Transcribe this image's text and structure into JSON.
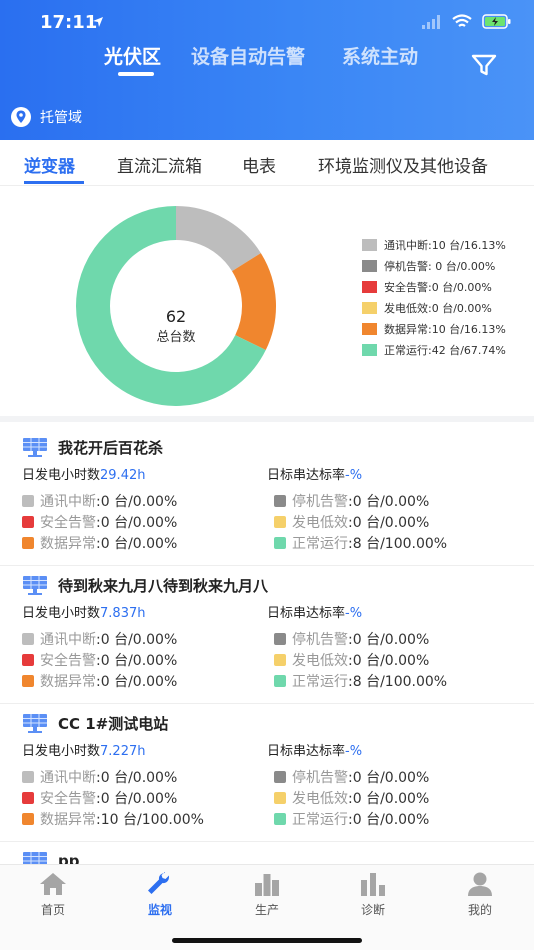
{
  "status_bar": {
    "time": "17:11"
  },
  "top_tabs": [
    {
      "label": "光伏区",
      "active": true
    },
    {
      "label": "设备自动告警",
      "active": false
    },
    {
      "label": "系统主动",
      "active": false
    }
  ],
  "domain": {
    "label": "托管域"
  },
  "sub_tabs": [
    {
      "label": "逆变器",
      "active": true
    },
    {
      "label": "直流汇流箱",
      "active": false
    },
    {
      "label": "电表",
      "active": false
    },
    {
      "label": "环境监测仪及其他设备",
      "active": false
    }
  ],
  "summary": {
    "total_value": "62",
    "total_label": "总台数",
    "legend": [
      {
        "text": "通讯中断:10 台/16.13%",
        "color": "#bdbdbd"
      },
      {
        "text": "停机告警: 0 台/0.00%",
        "color": "#8a8a8a"
      },
      {
        "text": "安全告警:0 台/0.00%",
        "color": "#e63b3b"
      },
      {
        "text": "发电低效:0 台/0.00%",
        "color": "#f5d06a"
      },
      {
        "text": "数据异常:10 台/16.13%",
        "color": "#f0862e"
      },
      {
        "text": "正常运行:42 台/67.74%",
        "color": "#6fd8ac"
      }
    ],
    "segments": [
      {
        "label": "通讯中断",
        "value": 10,
        "color": "#bdbdbd"
      },
      {
        "label": "数据异常",
        "value": 10,
        "color": "#f0862e"
      },
      {
        "label": "正常运行",
        "value": 42,
        "color": "#6fd8ac"
      }
    ]
  },
  "stations": [
    {
      "name": "我花开后百花杀",
      "daily_hours_label": "日发电小时数",
      "daily_hours_value": "29.42h",
      "rate_label": "日标串达标率",
      "rate_value": "-%",
      "statuses": [
        {
          "label": "通讯中断",
          "value": ":0 台/0.00%",
          "color": "#bdbdbd"
        },
        {
          "label": "停机告警",
          "value": ":0 台/0.00%",
          "color": "#8a8a8a"
        },
        {
          "label": "安全告警",
          "value": ":0 台/0.00%",
          "color": "#e63b3b"
        },
        {
          "label": "发电低效",
          "value": ":0 台/0.00%",
          "color": "#f5d06a"
        },
        {
          "label": "数据异常",
          "value": ":0 台/0.00%",
          "color": "#f0862e"
        },
        {
          "label": "正常运行",
          "value": ":8 台/100.00%",
          "color": "#6fd8ac"
        }
      ]
    },
    {
      "name": "待到秋来九月八待到秋来九月八",
      "daily_hours_label": "日发电小时数",
      "daily_hours_value": "7.837h",
      "rate_label": "日标串达标率",
      "rate_value": "-%",
      "statuses": [
        {
          "label": "通讯中断",
          "value": ":0 台/0.00%",
          "color": "#bdbdbd"
        },
        {
          "label": "停机告警",
          "value": ":0 台/0.00%",
          "color": "#8a8a8a"
        },
        {
          "label": "安全告警",
          "value": ":0 台/0.00%",
          "color": "#e63b3b"
        },
        {
          "label": "发电低效",
          "value": ":0 台/0.00%",
          "color": "#f5d06a"
        },
        {
          "label": "数据异常",
          "value": ":0 台/0.00%",
          "color": "#f0862e"
        },
        {
          "label": "正常运行",
          "value": ":8 台/100.00%",
          "color": "#6fd8ac"
        }
      ]
    },
    {
      "name": "CC 1#测试电站",
      "daily_hours_label": "日发电小时数",
      "daily_hours_value": "7.227h",
      "rate_label": "日标串达标率",
      "rate_value": "-%",
      "statuses": [
        {
          "label": "通讯中断",
          "value": ":0 台/0.00%",
          "color": "#bdbdbd"
        },
        {
          "label": "停机告警",
          "value": ":0 台/0.00%",
          "color": "#8a8a8a"
        },
        {
          "label": "安全告警",
          "value": ":0 台/0.00%",
          "color": "#e63b3b"
        },
        {
          "label": "发电低效",
          "value": ":0 台/0.00%",
          "color": "#f5d06a"
        },
        {
          "label": "数据异常",
          "value": ":10 台/100.00%",
          "color": "#f0862e"
        },
        {
          "label": "正常运行",
          "value": ":0 台/0.00%",
          "color": "#6fd8ac"
        }
      ]
    },
    {
      "name": "pp",
      "daily_hours_label": "",
      "daily_hours_value": "",
      "rate_label": "",
      "rate_value": "",
      "statuses": []
    }
  ],
  "bottom_nav": [
    {
      "label": "首页",
      "icon": "home-icon",
      "active": false
    },
    {
      "label": "监视",
      "icon": "wrench-icon",
      "active": true
    },
    {
      "label": "生产",
      "icon": "bar-chart-icon",
      "active": false
    },
    {
      "label": "诊断",
      "icon": "diagnosis-icon",
      "active": false
    },
    {
      "label": "我的",
      "icon": "user-icon",
      "active": false
    }
  ]
}
